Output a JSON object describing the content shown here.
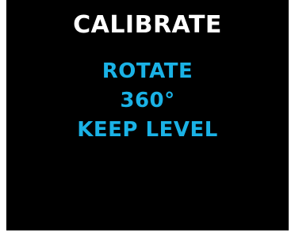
{
  "screen": {
    "title": "CALIBRATE",
    "lines": [
      "ROTATE",
      "360°",
      "KEEP LEVEL"
    ]
  },
  "colors": {
    "background": "#000000",
    "title": "#ffffff",
    "instruction": "#1ab2e6"
  }
}
